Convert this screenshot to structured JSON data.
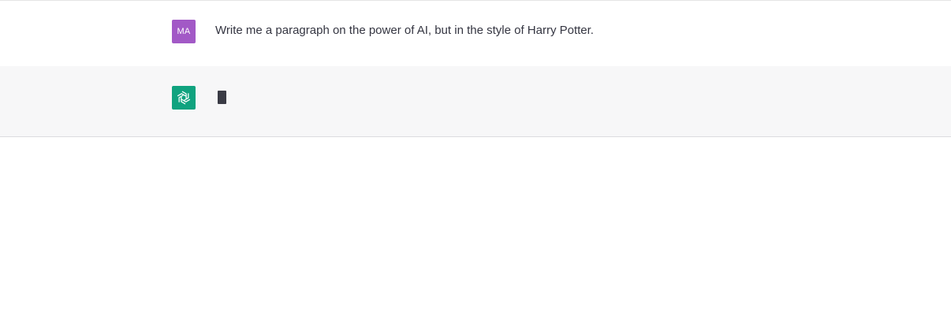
{
  "conversation": {
    "user_message": {
      "avatar_initials": "MA",
      "avatar_color": "#a259c6",
      "text": "Write me a paragraph on the power of AI, but in the style of Harry Potter."
    },
    "assistant_message": {
      "avatar_icon": "openai-logo-icon",
      "avatar_color": "#10a37f",
      "state": "typing",
      "cursor_color": "#3a3b45"
    }
  }
}
